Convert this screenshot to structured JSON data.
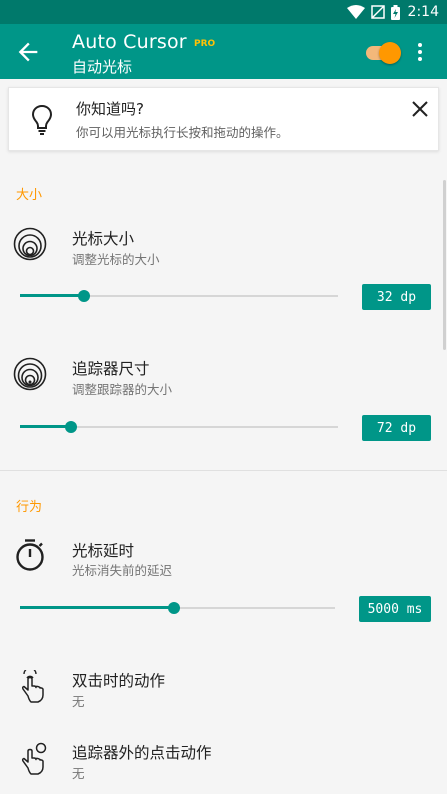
{
  "status_bar": {
    "time": "2:14"
  },
  "app_bar": {
    "title": "Auto Cursor",
    "pro_badge": "PRO",
    "subtitle": "自动光标",
    "master_toggle_on": true
  },
  "tip": {
    "title": "你知道吗?",
    "text": "你可以用光标执行长按和拖动的操作。"
  },
  "sections": {
    "size": {
      "header": "大小"
    },
    "behavior": {
      "header": "行为"
    }
  },
  "prefs": {
    "cursor_size": {
      "title": "光标大小",
      "summary": "调整光标的大小",
      "value": "32 dp",
      "slider_fraction": 0.2
    },
    "tracker_size": {
      "title": "追踪器尺寸",
      "summary": "调整跟踪器的大小",
      "value": "72 dp",
      "slider_fraction": 0.16
    },
    "cursor_delay": {
      "title": "光标延时",
      "summary": "光标消失前的延迟",
      "value": "5000 ms",
      "slider_fraction": 0.49
    },
    "double_tap_action": {
      "title": "双击时的动作",
      "summary": "无"
    },
    "outside_tap_action": {
      "title": "追踪器外的点击动作",
      "summary": "无"
    }
  },
  "colors": {
    "primary": "#009688",
    "primary_dark": "#00796b",
    "accent": "#ff9800",
    "background": "#f5f5f5"
  },
  "icons": {
    "back": "arrow-back-icon",
    "overflow": "more-vert-icon",
    "tip": "lightbulb-icon",
    "close": "close-icon",
    "cursor_size": "concentric-circles-icon",
    "tracker_size": "tracker-icon",
    "delay": "stopwatch-icon",
    "double_tap": "double-tap-hand-icon",
    "outside_tap": "tap-outside-hand-icon"
  }
}
